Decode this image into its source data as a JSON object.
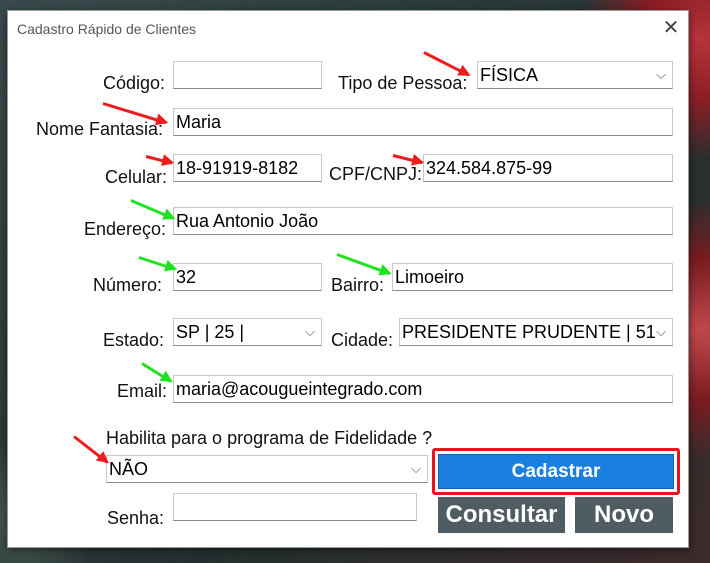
{
  "window": {
    "title": "Cadastro Rápido de Clientes",
    "close_icon": "close-icon"
  },
  "form": {
    "codigo": {
      "label": "Código:",
      "value": ""
    },
    "tipo_pessoa": {
      "label": "Tipo de Pessoa:",
      "value": "FÍSICA"
    },
    "nome_fantasia": {
      "label": "Nome Fantasia:",
      "value": "Maria"
    },
    "celular": {
      "label": "Celular:",
      "value": "18-91919-8182"
    },
    "cpf_cnpj": {
      "label": "CPF/CNPJ:",
      "value": "324.584.875-99"
    },
    "endereco": {
      "label": "Endereço:",
      "value": "Rua Antonio João"
    },
    "numero": {
      "label": "Número:",
      "value": "32"
    },
    "bairro": {
      "label": "Bairro:",
      "value": "Limoeiro"
    },
    "estado": {
      "label": "Estado:",
      "value": "SP | 25 |"
    },
    "cidade": {
      "label": "Cidade:",
      "value": "PRESIDENTE PRUDENTE | 51"
    },
    "email": {
      "label": "Email:",
      "value": "maria@acougueintegrado.com"
    },
    "fidelidade": {
      "label": "Habilita para o programa de Fidelidade ?",
      "value": "NÃO"
    },
    "senha": {
      "label": "Senha:",
      "value": ""
    }
  },
  "buttons": {
    "cadastrar": "Cadastrar",
    "consultar": "Consultar",
    "novo": "Novo"
  },
  "colors": {
    "primary": "#1a7fe0",
    "secondary": "#4f5d63",
    "highlight": "#e8141c",
    "arrow_red": "#ee1c1c",
    "arrow_green": "#22e022"
  }
}
